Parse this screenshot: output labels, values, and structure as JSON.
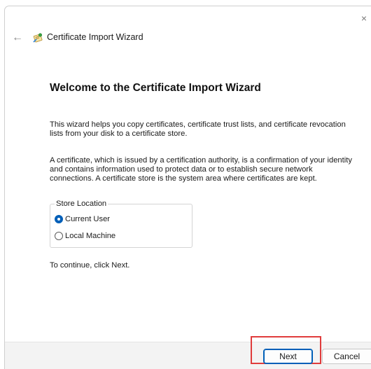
{
  "window": {
    "title": "Certificate Import Wizard",
    "close_glyph": "×",
    "back_glyph": "←"
  },
  "icons": {
    "back": "back-arrow-icon",
    "certificate": "certificate-icon",
    "close": "close-icon"
  },
  "content": {
    "heading": "Welcome to the Certificate Import Wizard",
    "paragraph_1": "This wizard helps you copy certificates, certificate trust lists, and certificate revocation lists from your disk to a certificate store.",
    "paragraph_2": "A certificate, which is issued by a certification authority, is a confirmation of your identity and contains information used to protect data or to establish secure network connections. A certificate store is the system area where certificates are kept.",
    "continue_text": "To continue, click Next."
  },
  "store_location": {
    "legend": "Store Location",
    "options": [
      {
        "label": "Current User",
        "selected": true
      },
      {
        "label": "Local Machine",
        "selected": false
      }
    ]
  },
  "footer": {
    "next_label": "Next",
    "cancel_label": "Cancel"
  },
  "colors": {
    "accent": "#005fb8",
    "highlight": "#e03c3c",
    "footer_bg": "#f3f3f3"
  }
}
